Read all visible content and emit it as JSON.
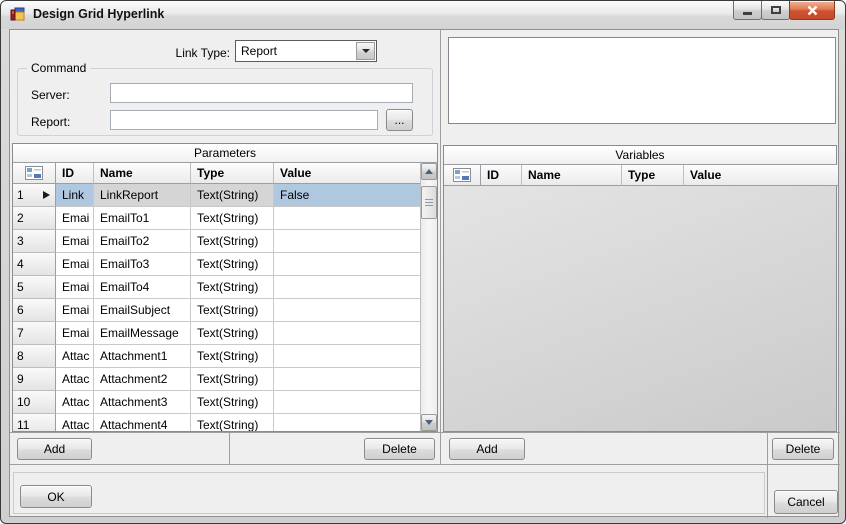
{
  "window": {
    "title": "Design Grid Hyperlink"
  },
  "titlebar": {
    "minimize_icon": "minimize",
    "maximize_icon": "maximize",
    "close_icon": "close-x"
  },
  "link_type": {
    "label": "Link Type:",
    "value": "Report"
  },
  "command": {
    "title": "Command",
    "server_label": "Server:",
    "server_value": "",
    "report_label": "Report:",
    "report_value": "",
    "browse_label": "..."
  },
  "parameters": {
    "caption": "Parameters",
    "columns": [
      "ID",
      "Name",
      "Type",
      "Value"
    ],
    "rows": [
      {
        "num": "1",
        "id": "Link",
        "name": "LinkReport",
        "type": "Text(String)",
        "value": "False",
        "selected": true
      },
      {
        "num": "2",
        "id": "Emai",
        "name": "EmailTo1",
        "type": "Text(String)",
        "value": "",
        "selected": false
      },
      {
        "num": "3",
        "id": "Emai",
        "name": "EmailTo2",
        "type": "Text(String)",
        "value": "",
        "selected": false
      },
      {
        "num": "4",
        "id": "Emai",
        "name": "EmailTo3",
        "type": "Text(String)",
        "value": "",
        "selected": false
      },
      {
        "num": "5",
        "id": "Emai",
        "name": "EmailTo4",
        "type": "Text(String)",
        "value": "",
        "selected": false
      },
      {
        "num": "6",
        "id": "Emai",
        "name": "EmailSubject",
        "type": "Text(String)",
        "value": "",
        "selected": false
      },
      {
        "num": "7",
        "id": "Emai",
        "name": "EmailMessage",
        "type": "Text(String)",
        "value": "",
        "selected": false
      },
      {
        "num": "8",
        "id": "Attac",
        "name": "Attachment1",
        "type": "Text(String)",
        "value": "",
        "selected": false
      },
      {
        "num": "9",
        "id": "Attac",
        "name": "Attachment2",
        "type": "Text(String)",
        "value": "",
        "selected": false
      },
      {
        "num": "10",
        "id": "Attac",
        "name": "Attachment3",
        "type": "Text(String)",
        "value": "",
        "selected": false
      },
      {
        "num": "11",
        "id": "Attac",
        "name": "Attachment4",
        "type": "Text(String)",
        "value": "",
        "selected": false
      }
    ],
    "add_label": "Add",
    "delete_label": "Delete"
  },
  "variables": {
    "caption": "Variables",
    "columns": [
      "ID",
      "Name",
      "Type",
      "Value"
    ],
    "rows": [],
    "add_label": "Add",
    "delete_label": "Delete"
  },
  "footer": {
    "ok_label": "OK",
    "cancel_label": "Cancel"
  },
  "colors": {
    "selection_blue": "#b0c7e0",
    "selection_gray": "#d5d5d5",
    "close_button_red": "#cf5331",
    "client_background": "#efefef"
  }
}
